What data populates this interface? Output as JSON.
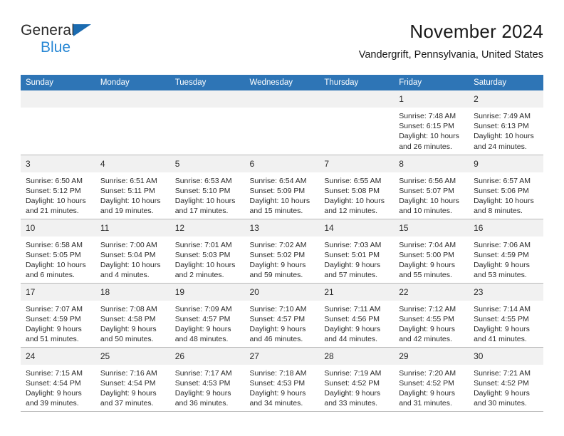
{
  "brand": {
    "line1": "General",
    "line2": "Blue",
    "triangle_color": "#1b6bb0",
    "blue_text_color": "#2787d4"
  },
  "header": {
    "title": "November 2024",
    "subtitle": "Vandergrift, Pennsylvania, United States",
    "accent_color": "#2e75b6"
  },
  "calendar": {
    "weekday_headers": [
      "Sunday",
      "Monday",
      "Tuesday",
      "Wednesday",
      "Thursday",
      "Friday",
      "Saturday"
    ],
    "labels": {
      "sunrise": "Sunrise:",
      "sunset": "Sunset:",
      "daylight": "Daylight:"
    },
    "weeks": [
      [
        {
          "day": ""
        },
        {
          "day": ""
        },
        {
          "day": ""
        },
        {
          "day": ""
        },
        {
          "day": ""
        },
        {
          "day": "1",
          "sunrise": "Sunrise: 7:48 AM",
          "sunset": "Sunset: 6:15 PM",
          "daylight": "Daylight: 10 hours and 26 minutes."
        },
        {
          "day": "2",
          "sunrise": "Sunrise: 7:49 AM",
          "sunset": "Sunset: 6:13 PM",
          "daylight": "Daylight: 10 hours and 24 minutes."
        }
      ],
      [
        {
          "day": "3",
          "sunrise": "Sunrise: 6:50 AM",
          "sunset": "Sunset: 5:12 PM",
          "daylight": "Daylight: 10 hours and 21 minutes."
        },
        {
          "day": "4",
          "sunrise": "Sunrise: 6:51 AM",
          "sunset": "Sunset: 5:11 PM",
          "daylight": "Daylight: 10 hours and 19 minutes."
        },
        {
          "day": "5",
          "sunrise": "Sunrise: 6:53 AM",
          "sunset": "Sunset: 5:10 PM",
          "daylight": "Daylight: 10 hours and 17 minutes."
        },
        {
          "day": "6",
          "sunrise": "Sunrise: 6:54 AM",
          "sunset": "Sunset: 5:09 PM",
          "daylight": "Daylight: 10 hours and 15 minutes."
        },
        {
          "day": "7",
          "sunrise": "Sunrise: 6:55 AM",
          "sunset": "Sunset: 5:08 PM",
          "daylight": "Daylight: 10 hours and 12 minutes."
        },
        {
          "day": "8",
          "sunrise": "Sunrise: 6:56 AM",
          "sunset": "Sunset: 5:07 PM",
          "daylight": "Daylight: 10 hours and 10 minutes."
        },
        {
          "day": "9",
          "sunrise": "Sunrise: 6:57 AM",
          "sunset": "Sunset: 5:06 PM",
          "daylight": "Daylight: 10 hours and 8 minutes."
        }
      ],
      [
        {
          "day": "10",
          "sunrise": "Sunrise: 6:58 AM",
          "sunset": "Sunset: 5:05 PM",
          "daylight": "Daylight: 10 hours and 6 minutes."
        },
        {
          "day": "11",
          "sunrise": "Sunrise: 7:00 AM",
          "sunset": "Sunset: 5:04 PM",
          "daylight": "Daylight: 10 hours and 4 minutes."
        },
        {
          "day": "12",
          "sunrise": "Sunrise: 7:01 AM",
          "sunset": "Sunset: 5:03 PM",
          "daylight": "Daylight: 10 hours and 2 minutes."
        },
        {
          "day": "13",
          "sunrise": "Sunrise: 7:02 AM",
          "sunset": "Sunset: 5:02 PM",
          "daylight": "Daylight: 9 hours and 59 minutes."
        },
        {
          "day": "14",
          "sunrise": "Sunrise: 7:03 AM",
          "sunset": "Sunset: 5:01 PM",
          "daylight": "Daylight: 9 hours and 57 minutes."
        },
        {
          "day": "15",
          "sunrise": "Sunrise: 7:04 AM",
          "sunset": "Sunset: 5:00 PM",
          "daylight": "Daylight: 9 hours and 55 minutes."
        },
        {
          "day": "16",
          "sunrise": "Sunrise: 7:06 AM",
          "sunset": "Sunset: 4:59 PM",
          "daylight": "Daylight: 9 hours and 53 minutes."
        }
      ],
      [
        {
          "day": "17",
          "sunrise": "Sunrise: 7:07 AM",
          "sunset": "Sunset: 4:59 PM",
          "daylight": "Daylight: 9 hours and 51 minutes."
        },
        {
          "day": "18",
          "sunrise": "Sunrise: 7:08 AM",
          "sunset": "Sunset: 4:58 PM",
          "daylight": "Daylight: 9 hours and 50 minutes."
        },
        {
          "day": "19",
          "sunrise": "Sunrise: 7:09 AM",
          "sunset": "Sunset: 4:57 PM",
          "daylight": "Daylight: 9 hours and 48 minutes."
        },
        {
          "day": "20",
          "sunrise": "Sunrise: 7:10 AM",
          "sunset": "Sunset: 4:57 PM",
          "daylight": "Daylight: 9 hours and 46 minutes."
        },
        {
          "day": "21",
          "sunrise": "Sunrise: 7:11 AM",
          "sunset": "Sunset: 4:56 PM",
          "daylight": "Daylight: 9 hours and 44 minutes."
        },
        {
          "day": "22",
          "sunrise": "Sunrise: 7:12 AM",
          "sunset": "Sunset: 4:55 PM",
          "daylight": "Daylight: 9 hours and 42 minutes."
        },
        {
          "day": "23",
          "sunrise": "Sunrise: 7:14 AM",
          "sunset": "Sunset: 4:55 PM",
          "daylight": "Daylight: 9 hours and 41 minutes."
        }
      ],
      [
        {
          "day": "24",
          "sunrise": "Sunrise: 7:15 AM",
          "sunset": "Sunset: 4:54 PM",
          "daylight": "Daylight: 9 hours and 39 minutes."
        },
        {
          "day": "25",
          "sunrise": "Sunrise: 7:16 AM",
          "sunset": "Sunset: 4:54 PM",
          "daylight": "Daylight: 9 hours and 37 minutes."
        },
        {
          "day": "26",
          "sunrise": "Sunrise: 7:17 AM",
          "sunset": "Sunset: 4:53 PM",
          "daylight": "Daylight: 9 hours and 36 minutes."
        },
        {
          "day": "27",
          "sunrise": "Sunrise: 7:18 AM",
          "sunset": "Sunset: 4:53 PM",
          "daylight": "Daylight: 9 hours and 34 minutes."
        },
        {
          "day": "28",
          "sunrise": "Sunrise: 7:19 AM",
          "sunset": "Sunset: 4:52 PM",
          "daylight": "Daylight: 9 hours and 33 minutes."
        },
        {
          "day": "29",
          "sunrise": "Sunrise: 7:20 AM",
          "sunset": "Sunset: 4:52 PM",
          "daylight": "Daylight: 9 hours and 31 minutes."
        },
        {
          "day": "30",
          "sunrise": "Sunrise: 7:21 AM",
          "sunset": "Sunset: 4:52 PM",
          "daylight": "Daylight: 9 hours and 30 minutes."
        }
      ]
    ]
  }
}
